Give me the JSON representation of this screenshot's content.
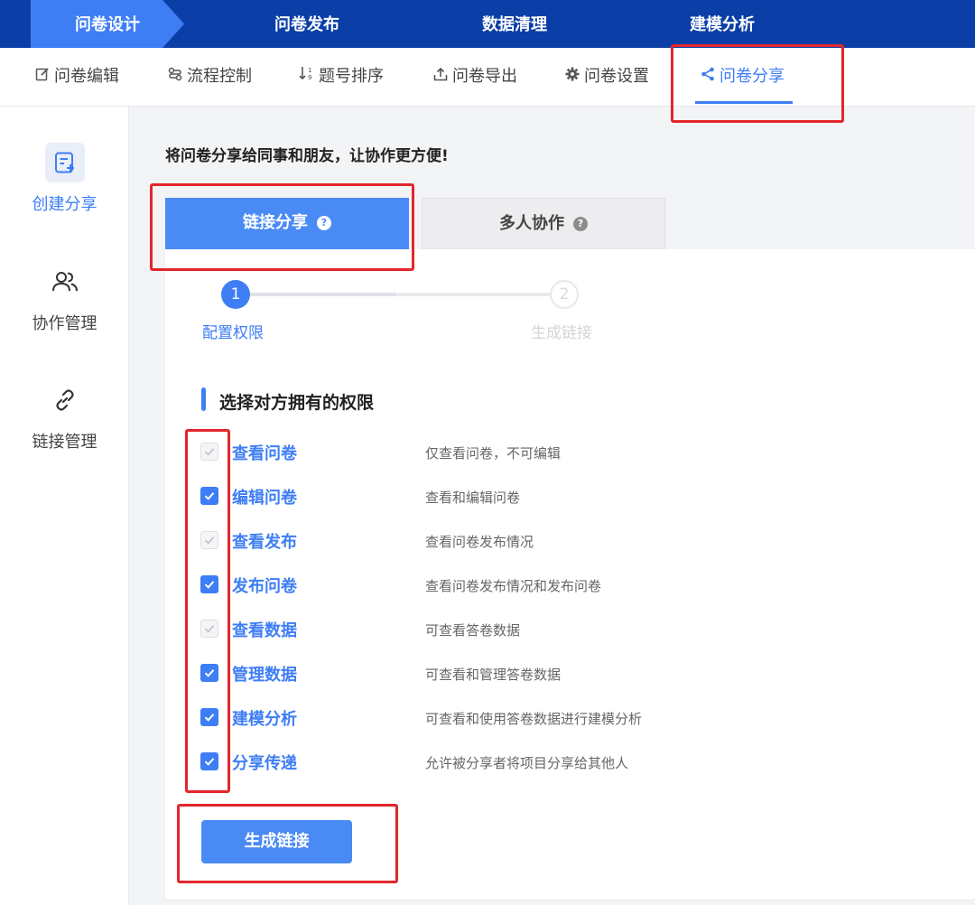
{
  "top_nav": {
    "tabs": [
      "问卷设计",
      "问卷发布",
      "数据清理",
      "建模分析"
    ],
    "active_index": 0
  },
  "sub_nav": {
    "items": [
      {
        "label": "问卷编辑",
        "icon": "edit-icon"
      },
      {
        "label": "流程控制",
        "icon": "flow-icon"
      },
      {
        "label": "题号排序",
        "icon": "sort-icon"
      },
      {
        "label": "问卷导出",
        "icon": "export-icon"
      },
      {
        "label": "问卷设置",
        "icon": "gear-icon"
      },
      {
        "label": "问卷分享",
        "icon": "share-icon"
      }
    ],
    "active_index": 5
  },
  "sidebar": {
    "items": [
      {
        "label": "创建分享",
        "icon": "create-share-icon"
      },
      {
        "label": "协作管理",
        "icon": "users-icon"
      },
      {
        "label": "链接管理",
        "icon": "link-icon"
      }
    ],
    "active_index": 0
  },
  "main": {
    "intro": "将问卷分享给同事和朋友，让协作更方便!",
    "modes": [
      {
        "label": "链接分享",
        "help": "?"
      },
      {
        "label": "多人协作",
        "help": "?"
      }
    ],
    "steps": [
      {
        "number": "1",
        "label": "配置权限"
      },
      {
        "number": "2",
        "label": "生成链接"
      }
    ],
    "section_title": "选择对方拥有的权限",
    "permissions": [
      {
        "name": "查看问卷",
        "desc": "仅查看问卷，不可编辑",
        "state": "disabled-checked"
      },
      {
        "name": "编辑问卷",
        "desc": "查看和编辑问卷",
        "state": "checked"
      },
      {
        "name": "查看发布",
        "desc": "查看问卷发布情况",
        "state": "disabled-checked"
      },
      {
        "name": "发布问卷",
        "desc": "查看问卷发布情况和发布问卷",
        "state": "checked"
      },
      {
        "name": "查看数据",
        "desc": "可查看答卷数据",
        "state": "disabled-checked"
      },
      {
        "name": "管理数据",
        "desc": "可查看和管理答卷数据",
        "state": "checked"
      },
      {
        "name": "建模分析",
        "desc": "可查看和使用答卷数据进行建模分析",
        "state": "checked"
      },
      {
        "name": "分享传递",
        "desc": "允许被分享者将项目分享给其他人",
        "state": "checked"
      }
    ],
    "generate_button": "生成链接"
  },
  "colors": {
    "nav_bg": "#0b3fa7",
    "accent": "#3e7ef5",
    "annotation_red": "#e3262c"
  }
}
